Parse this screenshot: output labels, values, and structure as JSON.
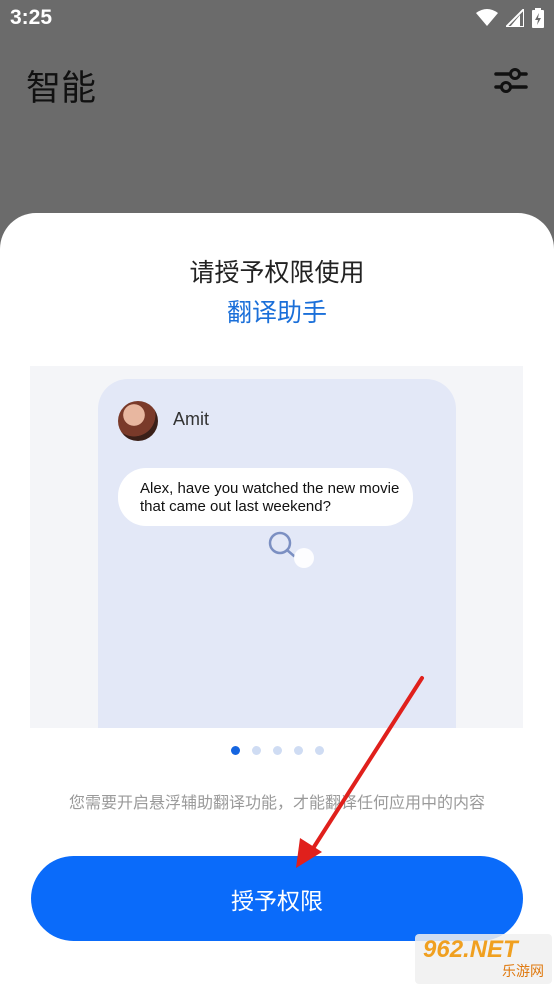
{
  "status_bar": {
    "time": "3:25"
  },
  "header": {
    "title": "智能",
    "settings_icon": "sliders-icon"
  },
  "dialog": {
    "title": "请授予权限使用",
    "subtitle": "翻译助手",
    "illustration": {
      "contact_name": "Amit",
      "message_line1": "Alex, have you watched the new movie",
      "message_line2": "that came out last weekend?"
    },
    "pager": {
      "count": 5,
      "active_index": 0
    },
    "description": "您需要开启悬浮辅助翻译功能，才能翻译任何应用中的内容",
    "grant_button_label": "授予权限"
  },
  "watermark": {
    "main": "962.NET",
    "sub": "乐游网"
  },
  "colors": {
    "accent": "#0a6bfa",
    "subtitle": "#1a6fd9",
    "arrow": "#e0201c"
  }
}
